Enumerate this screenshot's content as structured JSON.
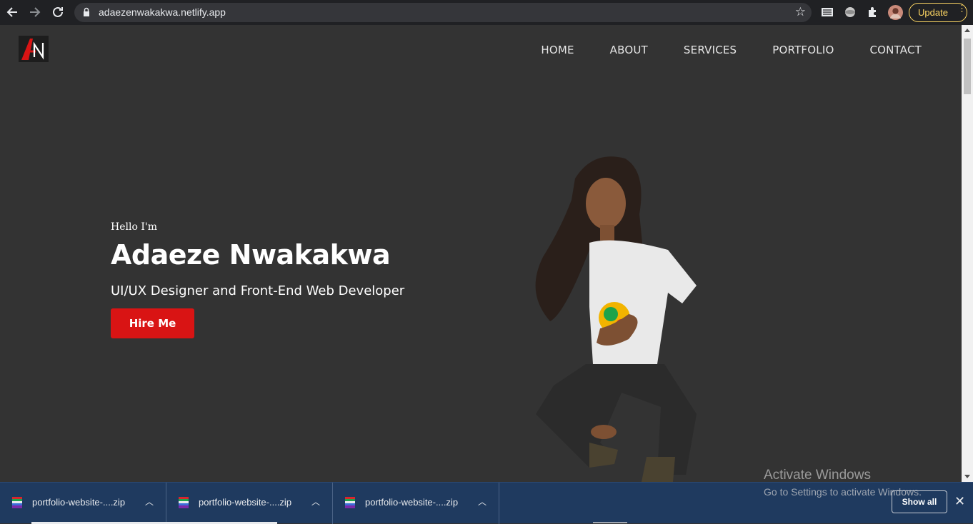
{
  "browser": {
    "url": "adaezenwakakwa.netlify.app",
    "update_label": "Update"
  },
  "nav": {
    "items": [
      "HOME",
      "ABOUT",
      "SERVICES",
      "PORTFOLIO",
      "CONTACT"
    ]
  },
  "hero": {
    "greeting": "Hello I'm",
    "name": "Adaeze Nwakakwa",
    "role": "UI/UX Designer and Front-End Web Developer",
    "cta_label": "Hire Me"
  },
  "colors": {
    "background": "#333333",
    "accent": "#d91414",
    "shelf": "#1f3a5f"
  },
  "watermark": {
    "title": "Activate Windows",
    "subtitle": "Go to Settings to activate Windows."
  },
  "downloads": {
    "items": [
      {
        "name": "portfolio-website-....zip"
      },
      {
        "name": "portfolio-website-....zip"
      },
      {
        "name": "portfolio-website-....zip"
      }
    ],
    "show_all_label": "Show all"
  }
}
